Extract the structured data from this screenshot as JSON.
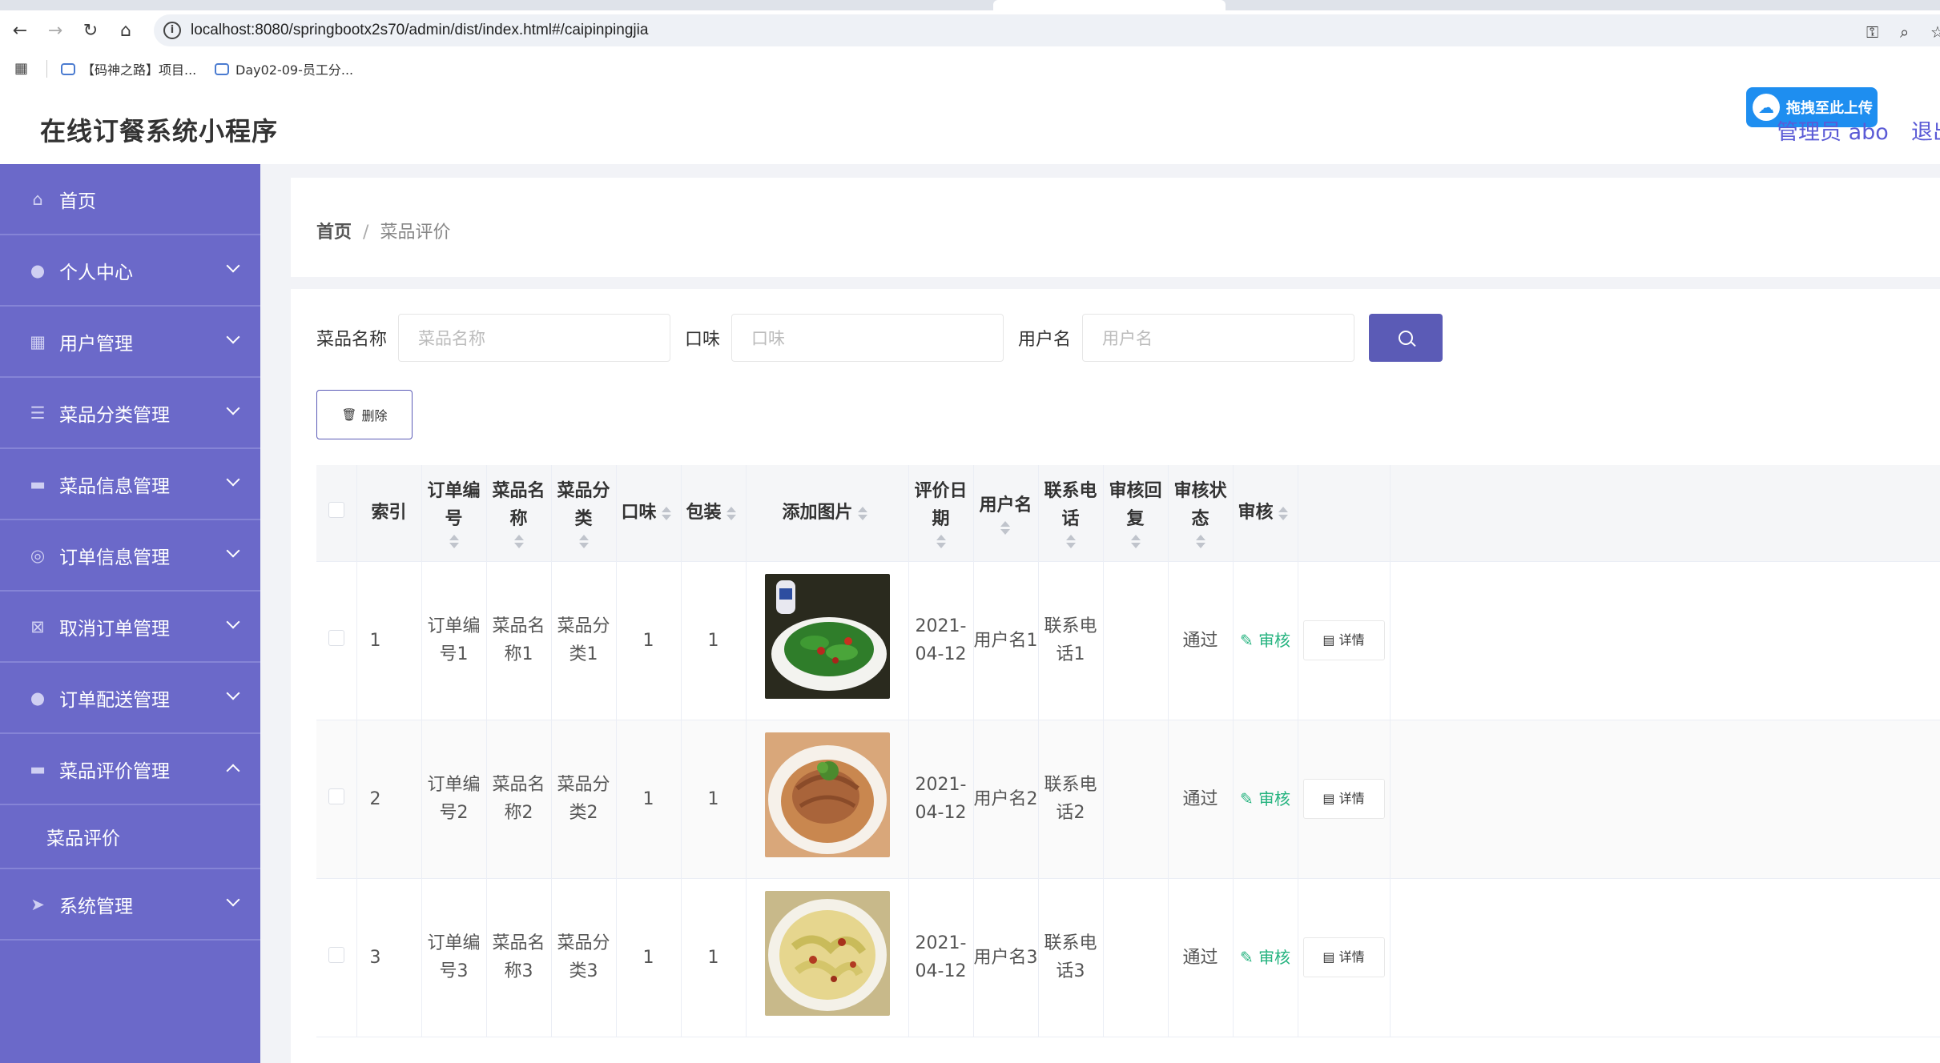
{
  "browser": {
    "url": "localhost:8080/springbootx2s70/admin/dist/index.html#/caipinpingjia",
    "bookmarks": [
      "【码神之路】项目...",
      "Day02-09-员工分..."
    ]
  },
  "header": {
    "app_title": "在线订餐系统小程序",
    "upload_badge": "拖拽至此上传",
    "admin_label": "管理员 abo",
    "logout": "退出"
  },
  "sidebar": {
    "items": [
      {
        "label": "首页",
        "icon": "home-icon"
      },
      {
        "label": "个人中心",
        "icon": "user-icon"
      },
      {
        "label": "用户管理",
        "icon": "grid-icon"
      },
      {
        "label": "菜品分类管理",
        "icon": "list-icon"
      },
      {
        "label": "菜品信息管理",
        "icon": "food-icon"
      },
      {
        "label": "订单信息管理",
        "icon": "order-icon"
      },
      {
        "label": "取消订单管理",
        "icon": "cancel-icon"
      },
      {
        "label": "订单配送管理",
        "icon": "delivery-icon"
      },
      {
        "label": "菜品评价管理",
        "icon": "monitor-icon",
        "expanded": true
      },
      {
        "label": "菜品评价",
        "sub": true
      },
      {
        "label": "系统管理",
        "icon": "send-icon"
      }
    ]
  },
  "breadcrumb": {
    "home": "首页",
    "sep": "/",
    "current": "菜品评价"
  },
  "search": {
    "fields": [
      {
        "label": "菜品名称",
        "placeholder": "菜品名称"
      },
      {
        "label": "口味",
        "placeholder": "口味"
      },
      {
        "label": "用户名",
        "placeholder": "用户名"
      }
    ]
  },
  "toolbar": {
    "delete_label": "删除"
  },
  "table": {
    "headers": [
      "索引",
      "订单编号",
      "菜品名称",
      "菜品分类",
      "口味",
      "包装",
      "添加图片",
      "评价日期",
      "用户名",
      "联系电话",
      "审核回复",
      "审核状态",
      "审核"
    ],
    "rows": [
      {
        "index": "1",
        "order_no": "订单编号1",
        "dish": "菜品名称1",
        "category": "菜品分类1",
        "taste": "1",
        "pack": "1",
        "date": "2021-04-12",
        "user": "用户名1",
        "phone": "联系电话1",
        "reply": "",
        "status": "通过",
        "audit": "审核",
        "detail": "详情"
      },
      {
        "index": "2",
        "order_no": "订单编号2",
        "dish": "菜品名称2",
        "category": "菜品分类2",
        "taste": "1",
        "pack": "1",
        "date": "2021-04-12",
        "user": "用户名2",
        "phone": "联系电话2",
        "reply": "",
        "status": "通过",
        "audit": "审核",
        "detail": "详情"
      },
      {
        "index": "3",
        "order_no": "订单编号3",
        "dish": "菜品名称3",
        "category": "菜品分类3",
        "taste": "1",
        "pack": "1",
        "date": "2021-04-12",
        "user": "用户名3",
        "phone": "联系电话3",
        "reply": "",
        "status": "通过",
        "audit": "审核",
        "detail": "详情"
      }
    ]
  },
  "colors": {
    "sidebar": "#6b69c9",
    "accent": "#5b5bb6",
    "audit_link": "#25b37f"
  }
}
